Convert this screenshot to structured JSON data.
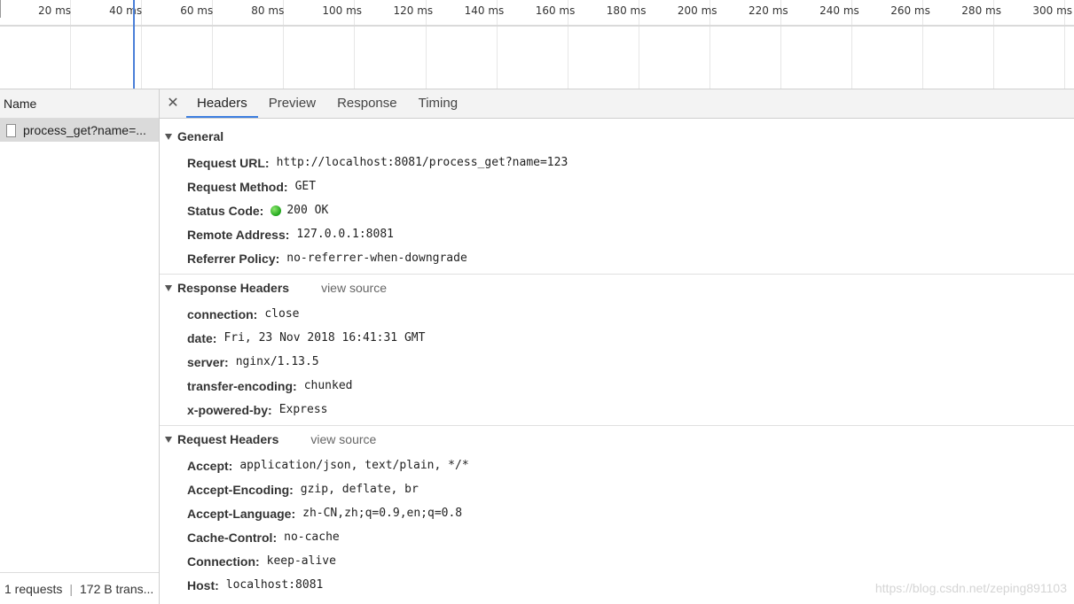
{
  "timeline": {
    "labels": [
      "20 ms",
      "40 ms",
      "60 ms",
      "80 ms",
      "100 ms",
      "120 ms",
      "140 ms",
      "160 ms",
      "180 ms",
      "200 ms",
      "220 ms",
      "240 ms",
      "260 ms",
      "280 ms",
      "300 ms"
    ]
  },
  "request_list": {
    "header": "Name",
    "items": [
      {
        "label": "process_get?name=..."
      }
    ],
    "footer": {
      "requests": "1 requests",
      "separator": "|",
      "transferred": "172 B trans..."
    }
  },
  "details": {
    "tabs": [
      "Headers",
      "Preview",
      "Response",
      "Timing"
    ],
    "active_tab": "Headers",
    "general": {
      "title": "General",
      "rows": [
        {
          "key": "Request URL:",
          "value": "http://localhost:8081/process_get?name=123"
        },
        {
          "key": "Request Method:",
          "value": "GET"
        },
        {
          "key": "Status Code:",
          "value": "200 OK"
        },
        {
          "key": "Remote Address:",
          "value": "127.0.0.1:8081"
        },
        {
          "key": "Referrer Policy:",
          "value": "no-referrer-when-downgrade"
        }
      ]
    },
    "response_headers": {
      "title": "Response Headers",
      "view_source": "view source",
      "rows": [
        {
          "key": "connection:",
          "value": "close"
        },
        {
          "key": "date:",
          "value": "Fri, 23 Nov 2018 16:41:31 GMT"
        },
        {
          "key": "server:",
          "value": "nginx/1.13.5"
        },
        {
          "key": "transfer-encoding:",
          "value": "chunked"
        },
        {
          "key": "x-powered-by:",
          "value": "Express"
        }
      ]
    },
    "request_headers": {
      "title": "Request Headers",
      "view_source": "view source",
      "rows": [
        {
          "key": "Accept:",
          "value": "application/json, text/plain, */*"
        },
        {
          "key": "Accept-Encoding:",
          "value": "gzip, deflate, br"
        },
        {
          "key": "Accept-Language:",
          "value": "zh-CN,zh;q=0.9,en;q=0.8"
        },
        {
          "key": "Cache-Control:",
          "value": "no-cache"
        },
        {
          "key": "Connection:",
          "value": "keep-alive"
        },
        {
          "key": "Host:",
          "value": "localhost:8081"
        }
      ]
    }
  },
  "watermark": "https://blog.csdn.net/zeping891103"
}
